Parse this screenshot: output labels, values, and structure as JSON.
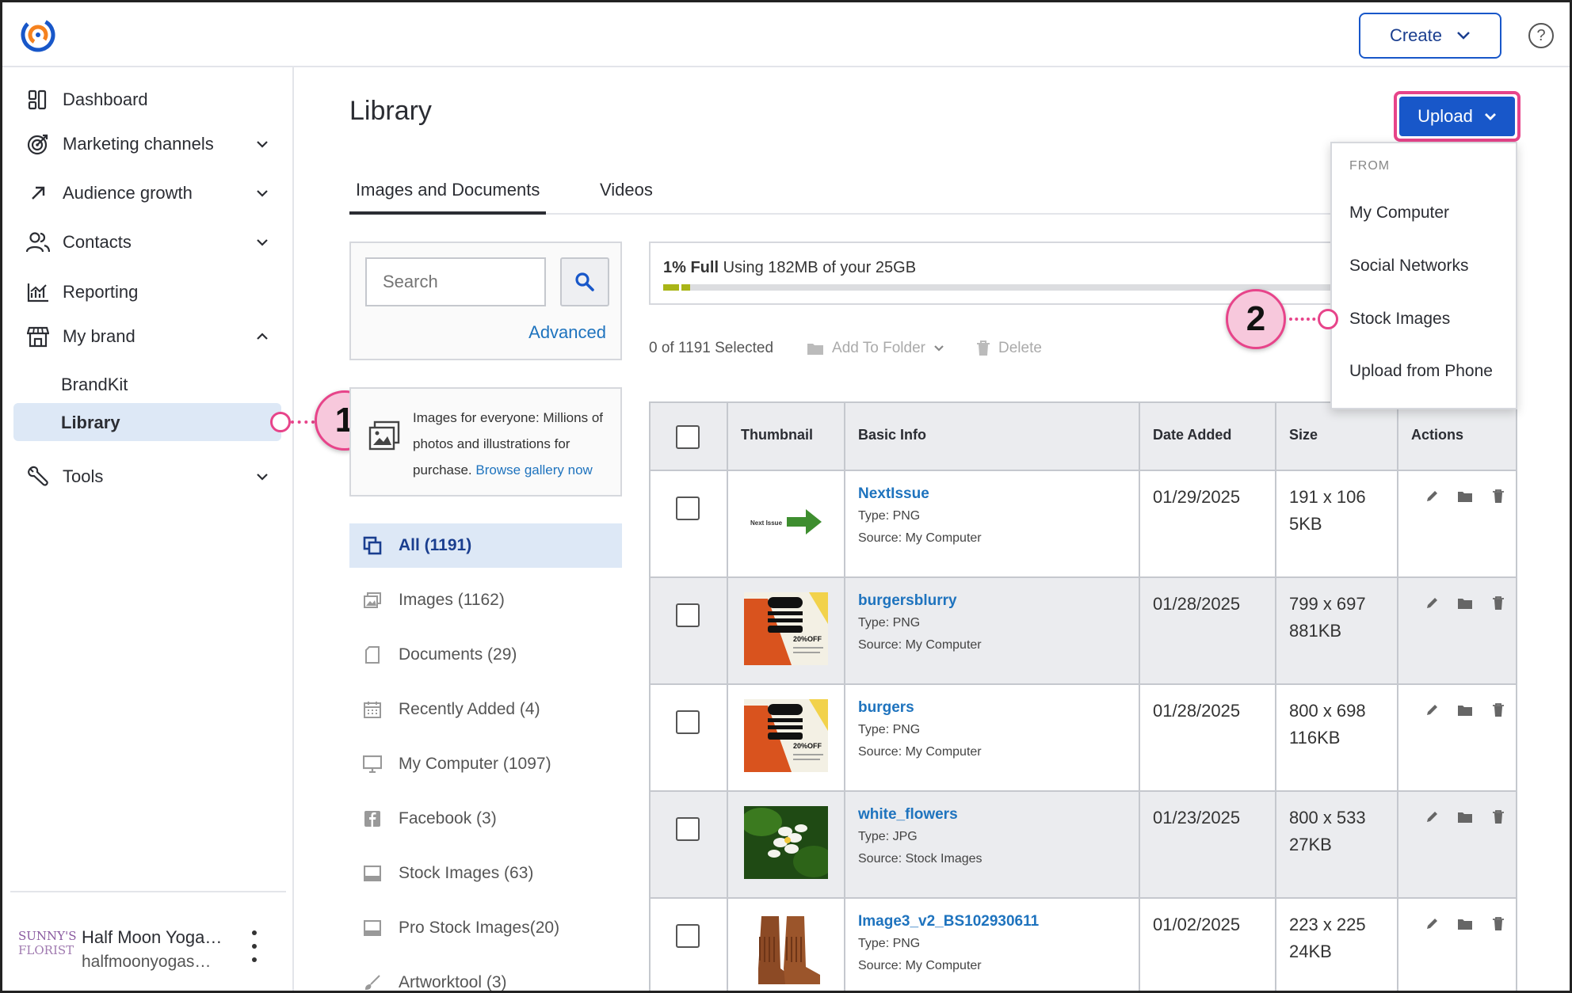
{
  "header": {
    "create_label": "Create",
    "help_symbol": "?"
  },
  "sidebar": {
    "items": [
      {
        "label": "Dashboard",
        "icon": "dashboard-icon"
      },
      {
        "label": "Marketing channels",
        "icon": "target-icon"
      },
      {
        "label": "Audience growth",
        "icon": "arrow-up-right-icon"
      },
      {
        "label": "Contacts",
        "icon": "people-icon"
      },
      {
        "label": "Reporting",
        "icon": "chart-icon"
      },
      {
        "label": "My brand",
        "icon": "store-icon"
      },
      {
        "label": "Tools",
        "icon": "wrench-icon"
      }
    ],
    "brand_sub": [
      {
        "label": "BrandKit"
      },
      {
        "label": "Library"
      }
    ],
    "account": {
      "logo_line1": "SUNNY'S",
      "logo_line2": "FLORIST",
      "name": "Half Moon Yoga…",
      "sub": "halfmoonyogas…"
    }
  },
  "callouts": {
    "one": "1",
    "two": "2"
  },
  "main": {
    "title": "Library",
    "upload_label": "Upload",
    "tabs": [
      {
        "label": "Images and Documents",
        "active": true
      },
      {
        "label": "Videos",
        "active": false
      }
    ],
    "search": {
      "placeholder": "Search",
      "advanced_label": "Advanced"
    },
    "promo": {
      "text": "Images for everyone: Millions of photos and illustrations for purchase.",
      "link": "Browse gallery now"
    },
    "filters": [
      {
        "label": "All (1191)",
        "icon": "all-items-icon",
        "active": true
      },
      {
        "label": "Images (1162)",
        "icon": "image-icon",
        "active": false
      },
      {
        "label": "Documents (29)",
        "icon": "document-icon",
        "active": false
      },
      {
        "label": "Recently Added (4)",
        "icon": "calendar-icon",
        "active": false
      },
      {
        "label": "My Computer (1097)",
        "icon": "monitor-icon",
        "active": false
      },
      {
        "label": "Facebook (3)",
        "icon": "facebook-icon",
        "active": false
      },
      {
        "label": "Stock Images (63)",
        "icon": "stock-icon",
        "active": false
      },
      {
        "label": "Pro Stock Images(20)",
        "icon": "stock-icon",
        "active": false
      },
      {
        "label": "Artworktool (3)",
        "icon": "brush-icon",
        "active": false
      }
    ],
    "storage": {
      "percent_label": "1% Full",
      "usage_label": "Using 182MB of your 25GB",
      "fill_fraction": 0.04
    },
    "toolbar": {
      "selected_label": "0 of 1191 Selected",
      "add_to_folder_label": "Add To Folder",
      "delete_label": "Delete"
    },
    "table": {
      "columns": [
        "Thumbnail",
        "Basic Info",
        "Date Added",
        "Size",
        "Actions"
      ],
      "rows": [
        {
          "name": "NextIssue",
          "type": "Type: PNG",
          "source": "Source: My Computer",
          "date": "01/29/2025",
          "dims": "191 x 106",
          "size": "5KB",
          "thumb": "arrow",
          "thumb_text": "Next Issue"
        },
        {
          "name": "burgersblurry",
          "type": "Type: PNG",
          "source": "Source: My Computer",
          "date": "01/28/2025",
          "dims": "799 x 697",
          "size": "881KB",
          "thumb": "burger",
          "thumb_text": "20%OFF"
        },
        {
          "name": "burgers",
          "type": "Type: PNG",
          "source": "Source: My Computer",
          "date": "01/28/2025",
          "dims": "800 x 698",
          "size": "116KB",
          "thumb": "burger",
          "thumb_text": "20%OFF"
        },
        {
          "name": "white_flowers",
          "type": "Type: JPG",
          "source": "Source: Stock Images",
          "date": "01/23/2025",
          "dims": "800 x 533",
          "size": "27KB",
          "thumb": "flower",
          "thumb_text": ""
        },
        {
          "name": "Image3_v2_BS102930611",
          "type": "Type: PNG",
          "source": "Source: My Computer",
          "date": "01/02/2025",
          "dims": "223 x 225",
          "size": "24KB",
          "thumb": "boots",
          "thumb_text": ""
        }
      ]
    }
  },
  "upload_menu": {
    "heading": "FROM",
    "items": [
      "My Computer",
      "Social Networks",
      "Stock Images",
      "Upload from Phone"
    ]
  },
  "colors": {
    "primary": "#1857c9",
    "link": "#1e73be",
    "callout": "#e7448a",
    "active_bg": "#dde8f6",
    "storage_fill": "#a9b517"
  }
}
